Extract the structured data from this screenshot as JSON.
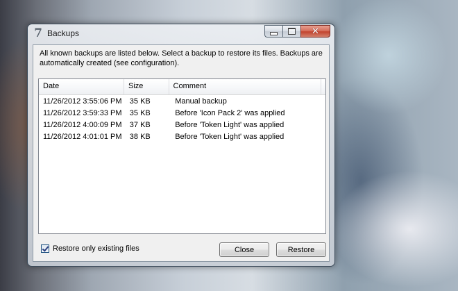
{
  "window": {
    "title": "Backups",
    "icon": "seven-icon",
    "icon_glyph": "7",
    "close_glyph": "✕"
  },
  "description": "All known backups are listed below. Select a backup to restore its files. Backups are automatically created (see configuration).",
  "list": {
    "columns": [
      "Date",
      "Size",
      "Comment"
    ],
    "rows": [
      {
        "date": "11/26/2012 3:55:06 PM",
        "size": "35 KB",
        "comment": "Manual backup"
      },
      {
        "date": "11/26/2012 3:59:33 PM",
        "size": "35 KB",
        "comment": "Before 'Icon Pack 2' was applied"
      },
      {
        "date": "11/26/2012 4:00:09 PM",
        "size": "37 KB",
        "comment": "Before 'Token Light' was applied"
      },
      {
        "date": "11/26/2012 4:01:01 PM",
        "size": "38 KB",
        "comment": "Before 'Token Light' was applied"
      }
    ]
  },
  "options": {
    "restore_existing_label": "Restore only existing files",
    "restore_existing_checked": true
  },
  "buttons": {
    "close_label": "Close",
    "restore_label": "Restore"
  }
}
